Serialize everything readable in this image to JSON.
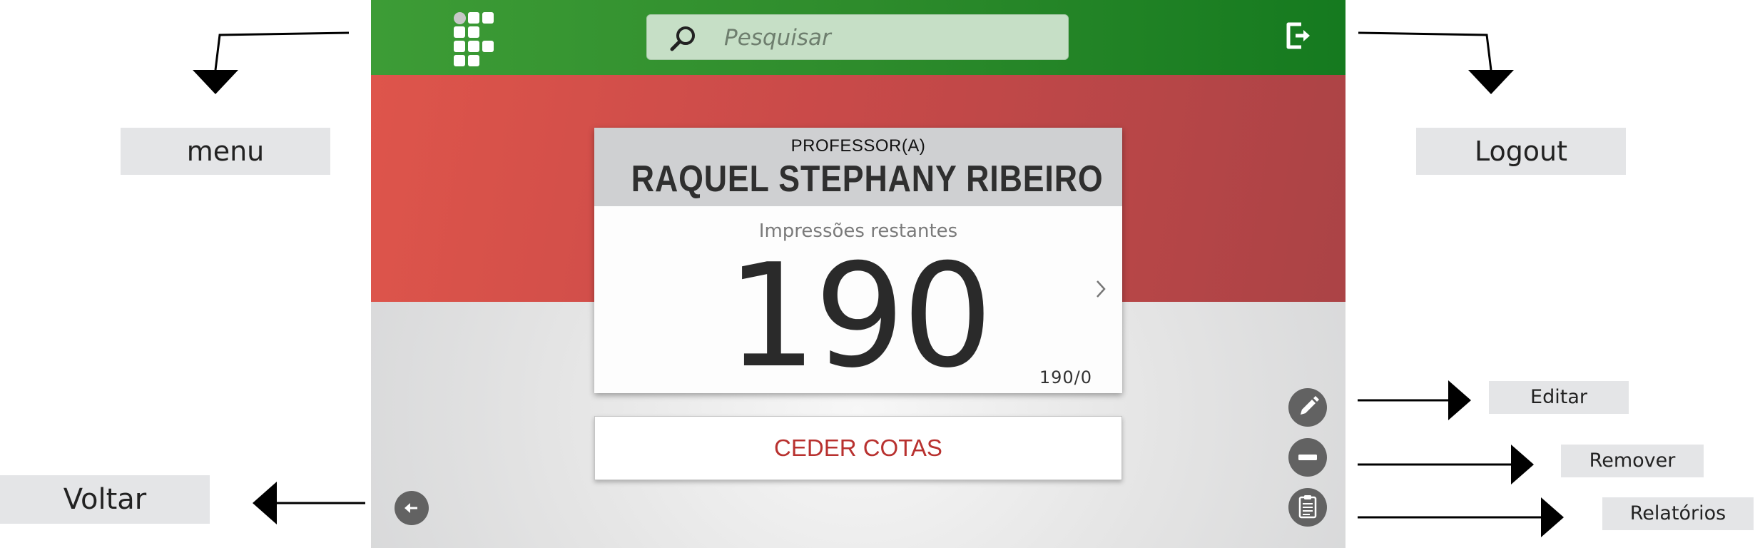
{
  "header": {
    "search_placeholder": "Pesquisar",
    "logo_icon": "grid-logo-icon",
    "search_icon": "search-icon",
    "logout_icon": "logout-icon"
  },
  "card": {
    "role": "PROFESSOR(A)",
    "name": "RAQUEL STEPHANY RIBEIRO",
    "subtitle": "Impressões restantes",
    "remaining": "190",
    "ratio": "190/0"
  },
  "actions": {
    "cede_label": "CEDER COTAS",
    "edit_icon": "pencil-icon",
    "remove_icon": "minus-icon",
    "reports_icon": "clipboard-icon",
    "back_icon": "arrow-left-icon"
  },
  "annotations": {
    "menu": "menu",
    "logout": "Logout",
    "editar": "Editar",
    "remover": "Remover",
    "relatorios": "Relatórios",
    "voltar": "Voltar"
  },
  "colors": {
    "topbar": "#2e8c2c",
    "band": "#c94a49",
    "accent_text": "#b8312f",
    "fab": "#626262"
  }
}
